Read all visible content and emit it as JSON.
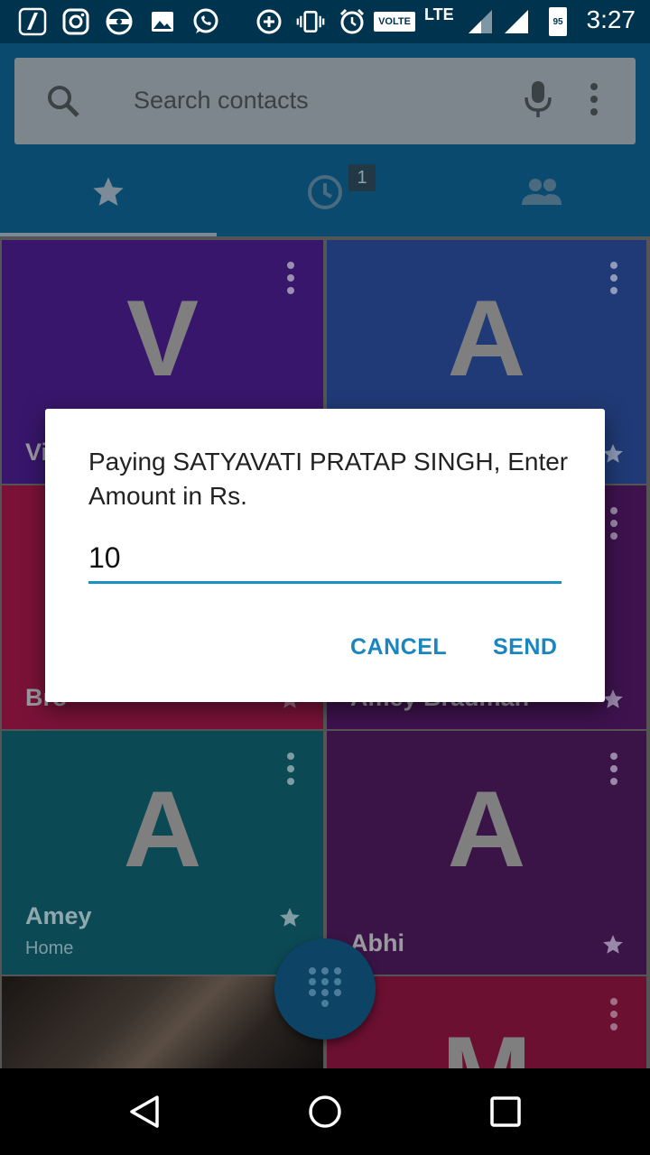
{
  "status_bar": {
    "time": "3:27",
    "network_label": "VOLTE",
    "lte_label": "LTE",
    "battery_level": "95",
    "icons": [
      "app-icon",
      "instagram-icon",
      "sync-icon",
      "gallery-icon",
      "whatsapp-icon",
      "data-saver-icon",
      "vibrate-icon",
      "alarm-icon",
      "signal-icon",
      "signal-icon",
      "battery-icon"
    ]
  },
  "search": {
    "placeholder": "Search contacts"
  },
  "tabs": {
    "recents_badge": "1",
    "items": [
      "favorites-tab",
      "recents-tab",
      "contacts-tab"
    ],
    "selected": "favorites"
  },
  "tiles": [
    {
      "initial": "V",
      "name": "Vi",
      "sub": "",
      "color": "#38166b"
    },
    {
      "initial": "A",
      "name": "",
      "sub": "",
      "color": "#1f3a76"
    },
    {
      "initial": "",
      "name": "Bro",
      "sub": "",
      "color": "#7a1238"
    },
    {
      "initial": "",
      "name": "Amey Bradman",
      "sub": "",
      "color": "#3d124d"
    },
    {
      "initial": "A",
      "name": "Amey",
      "sub": "Home",
      "color": "#0b4a55"
    },
    {
      "initial": "A",
      "name": "Abhi",
      "sub": "",
      "color": "#3b1447"
    },
    {
      "initial": "",
      "name": "",
      "sub": "",
      "color": "#2a2420"
    },
    {
      "initial": "M",
      "name": "",
      "sub": "",
      "color": "#6b1030"
    }
  ],
  "dialog": {
    "prompt": "Paying SATYAVATI PRATAP SINGH, Enter Amount in Rs.",
    "amount_value": "10",
    "cancel_label": "CANCEL",
    "send_label": "SEND"
  },
  "colors": {
    "accent": "#1a86c0",
    "header": "#0a4a6e",
    "status_bar": "#00334d"
  }
}
